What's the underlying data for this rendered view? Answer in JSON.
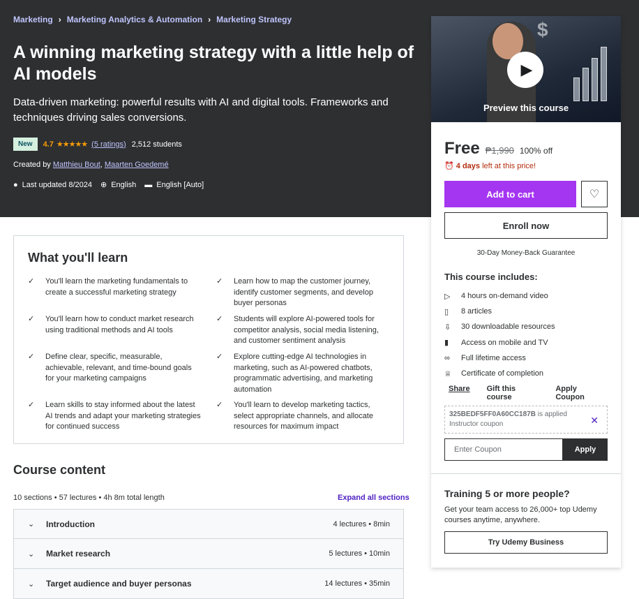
{
  "breadcrumb": [
    "Marketing",
    "Marketing Analytics & Automation",
    "Marketing Strategy"
  ],
  "course": {
    "title": "A winning marketing strategy with a little help of AI models",
    "subtitle": "Data-driven marketing: powerful results with AI and digital tools. Frameworks and techniques driving sales conversions.",
    "badge": "New",
    "rating": "4.7",
    "stars": "★★★★★",
    "ratings_link": "(5 ratings)",
    "students": "2,512 students",
    "created_by_label": "Created by",
    "authors": [
      "Matthieu Bout",
      "Maarten Goedemé"
    ],
    "last_updated": "Last updated 8/2024",
    "language": "English",
    "captions": "English [Auto]"
  },
  "sidebar": {
    "preview_label": "Preview this course",
    "price": "Free",
    "original_price": "₱1,990",
    "discount": "100% off",
    "time_left_bold": "4 days",
    "time_left_rest": "left at this price!",
    "add_to_cart": "Add to cart",
    "enroll_now": "Enroll now",
    "guarantee": "30-Day Money-Back Guarantee",
    "includes_title": "This course includes:",
    "includes": [
      {
        "icon": "video-icon",
        "glyph": "▷",
        "label": "4 hours on-demand video"
      },
      {
        "icon": "file-icon",
        "glyph": "▯",
        "label": "8 articles"
      },
      {
        "icon": "download-icon",
        "glyph": "⇩",
        "label": "30 downloadable resources"
      },
      {
        "icon": "mobile-icon",
        "glyph": "▮",
        "label": "Access on mobile and TV"
      },
      {
        "icon": "infinity-icon",
        "glyph": "∞",
        "label": "Full lifetime access"
      },
      {
        "icon": "trophy-icon",
        "glyph": "♕",
        "label": "Certificate of completion"
      }
    ],
    "share": "Share",
    "gift": "Gift this course",
    "apply_coupon": "Apply Coupon",
    "coupon_code": "325BEDF5FF0A60CC187B",
    "coupon_applied": "is applied",
    "coupon_type": "Instructor coupon",
    "coupon_placeholder": "Enter Coupon",
    "apply": "Apply",
    "training_title": "Training 5 or more people?",
    "training_desc": "Get your team access to 26,000+ top Udemy courses anytime, anywhere.",
    "try_business": "Try Udemy Business"
  },
  "learn": {
    "title": "What you'll learn",
    "items": [
      "You'll learn the marketing fundamentals to create a successful marketing strategy",
      "Learn how to map the customer journey, identify customer segments, and develop buyer personas",
      "You'll learn how to conduct market research using traditional methods and AI tools",
      "Students will explore AI-powered tools for competitor analysis, social media listening, and customer sentiment analysis",
      "Define clear, specific, measurable, achievable, relevant, and time-bound goals for your marketing campaigns",
      "Explore cutting-edge AI technologies in marketing, such as AI-powered chatbots, programmatic advertising, and marketing automation",
      "Learn skills to stay informed about the latest AI trends and adapt your marketing strategies for continued success",
      "You'll learn to develop marketing tactics, select appropriate channels, and allocate resources for maximum impact"
    ]
  },
  "content": {
    "title": "Course content",
    "meta": "10 sections • 57 lectures • 4h 8m total length",
    "expand": "Expand all sections",
    "sections": [
      {
        "name": "Introduction",
        "info": "4 lectures • 8min"
      },
      {
        "name": "Market research",
        "info": "5 lectures • 10min"
      },
      {
        "name": "Target audience and buyer personas",
        "info": "14 lectures • 35min"
      }
    ]
  },
  "colors": {
    "hero_bg": "#2d2f31",
    "accent_purple": "#a435f0",
    "link": "#c0c4fc",
    "star": "#f69c08",
    "urgency": "#b32d0f"
  }
}
